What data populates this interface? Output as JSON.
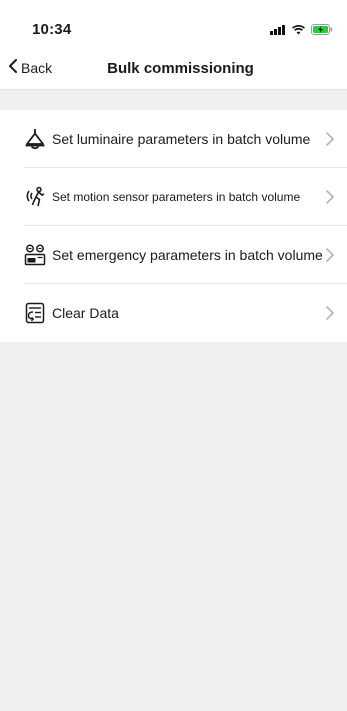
{
  "status_bar": {
    "time": "10:34",
    "icons": [
      "signal-icon",
      "wifi-icon",
      "battery-charging-icon"
    ]
  },
  "nav": {
    "back_label": "Back",
    "title": "Bulk commissioning"
  },
  "menu": {
    "items": [
      {
        "label": "Set luminaire parameters in batch volume",
        "icon": "luminaire-icon"
      },
      {
        "label": "Set motion sensor parameters in batch volume",
        "icon": "motion-sensor-icon"
      },
      {
        "label": "Set emergency parameters in batch volume",
        "icon": "emergency-icon"
      },
      {
        "label": "Clear Data",
        "icon": "clear-data-icon"
      }
    ]
  },
  "colors": {
    "background": "#f0f0f0",
    "surface": "#ffffff",
    "text": "#1a1a1a",
    "chevron": "#b5b5b5",
    "battery": "#39c24a"
  }
}
